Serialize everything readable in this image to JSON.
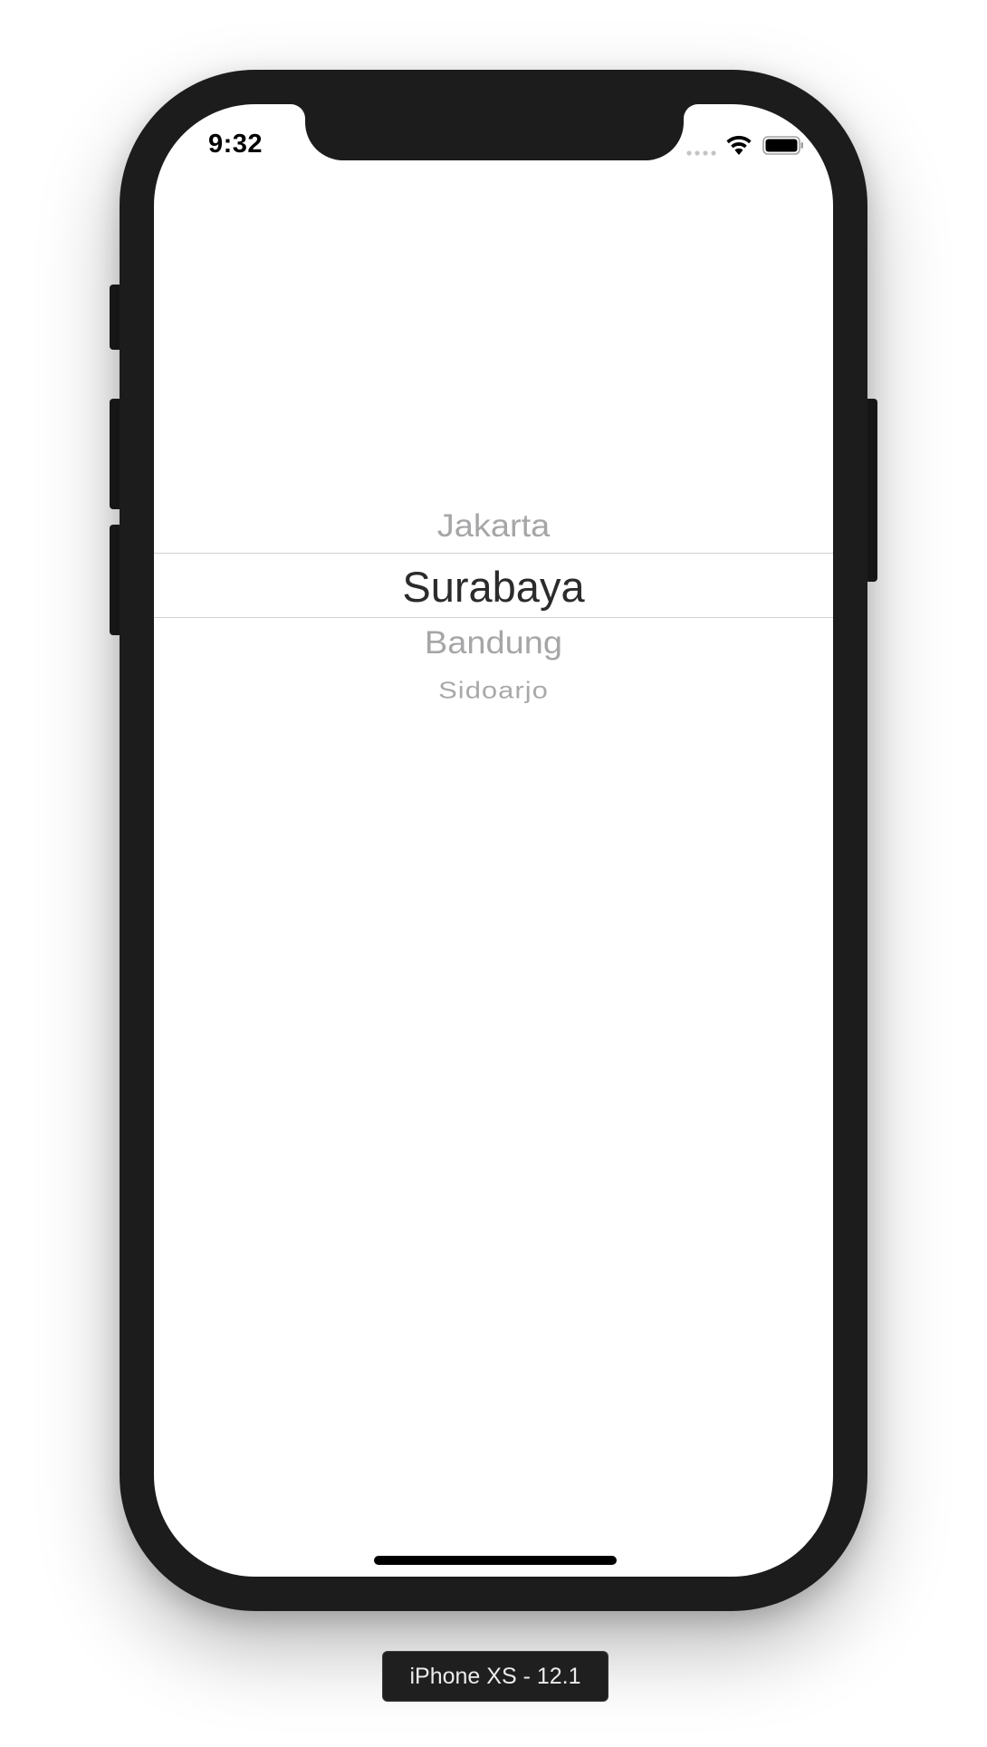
{
  "status_bar": {
    "time": "9:32",
    "icons": [
      "cellular-signal-icon",
      "wifi-icon",
      "battery-icon"
    ]
  },
  "picker": {
    "items": [
      {
        "label": "Jakarta",
        "selected": false
      },
      {
        "label": "Surabaya",
        "selected": true
      },
      {
        "label": "Bandung",
        "selected": false
      },
      {
        "label": "Sidoarjo",
        "selected": false
      }
    ],
    "selected_value": "Surabaya"
  },
  "simulator": {
    "device_label": "iPhone XS - 12.1"
  },
  "colors": {
    "frame": "#1c1c1c",
    "selected_text": "#2b2b2b",
    "unselected_text": "#a6a6a8",
    "selection_line": "#d2d2d4"
  }
}
